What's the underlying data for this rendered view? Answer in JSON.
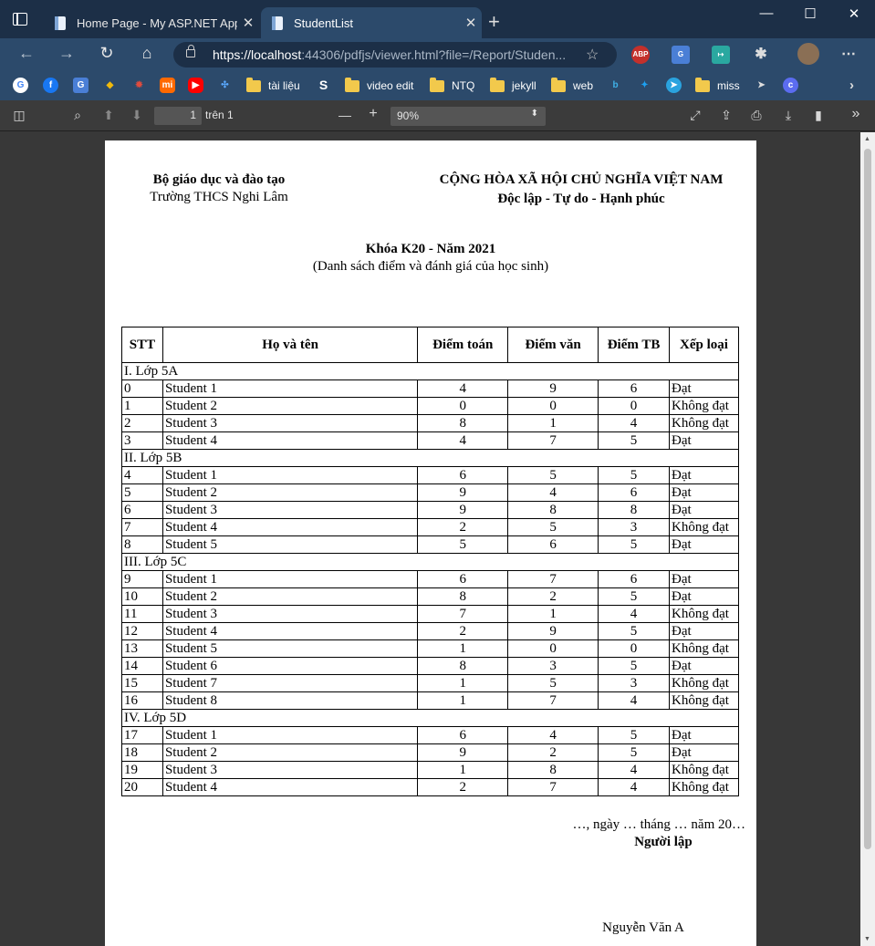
{
  "browser": {
    "tabs": [
      {
        "label": "Home Page - My ASP.NET Applic",
        "close": "✕"
      },
      {
        "label": "StudentList",
        "close": "✕"
      }
    ],
    "new_tab": "+",
    "window_controls": {
      "minimize": "—",
      "maximize": "☐",
      "close": "✕"
    },
    "url_host": "https://localhost",
    "url_rest": ":44306/pdfjs/viewer.html?file=/Report/Studen...",
    "bookmarks": [
      "tài liệu",
      "video edit",
      "NTQ",
      "jekyll",
      "web",
      "miss"
    ]
  },
  "pdf_toolbar": {
    "page_number": "1",
    "page_total": "trên 1",
    "zoom_minus": "—",
    "zoom_plus": "+",
    "zoom": "90%"
  },
  "document": {
    "ministry": "Bộ giáo dục và đào tạo",
    "school": "Trường THCS Nghi Lâm",
    "republic": "CỘNG HÒA XÃ HỘI CHỦ NGHĨA VIỆT NAM",
    "motto": "Độc lập - Tự do - Hạnh phúc",
    "course": "Khóa K20 - Năm 2021",
    "subtitle": "(Danh sách điểm và đánh giá của học sinh)",
    "columns": [
      "STT",
      "Họ và tên",
      "Điểm toán",
      "Điểm văn",
      "Điểm TB",
      "Xếp loại"
    ],
    "groups": [
      {
        "name": "I. Lớp 5A",
        "rows": [
          [
            "0",
            "Student 1",
            "4",
            "9",
            "6",
            "Đạt"
          ],
          [
            "1",
            "Student 2",
            "0",
            "0",
            "0",
            "Không đạt"
          ],
          [
            "2",
            "Student 3",
            "8",
            "1",
            "4",
            "Không đạt"
          ],
          [
            "3",
            "Student 4",
            "4",
            "7",
            "5",
            "Đạt"
          ]
        ]
      },
      {
        "name": "II. Lớp 5B",
        "rows": [
          [
            "4",
            "Student 1",
            "6",
            "5",
            "5",
            "Đạt"
          ],
          [
            "5",
            "Student 2",
            "9",
            "4",
            "6",
            "Đạt"
          ],
          [
            "6",
            "Student 3",
            "9",
            "8",
            "8",
            "Đạt"
          ],
          [
            "7",
            "Student 4",
            "2",
            "5",
            "3",
            "Không đạt"
          ],
          [
            "8",
            "Student 5",
            "5",
            "6",
            "5",
            "Đạt"
          ]
        ]
      },
      {
        "name": "III. Lớp 5C",
        "rows": [
          [
            "9",
            "Student 1",
            "6",
            "7",
            "6",
            "Đạt"
          ],
          [
            "10",
            "Student 2",
            "8",
            "2",
            "5",
            "Đạt"
          ],
          [
            "11",
            "Student 3",
            "7",
            "1",
            "4",
            "Không đạt"
          ],
          [
            "12",
            "Student 4",
            "2",
            "9",
            "5",
            "Đạt"
          ],
          [
            "13",
            "Student 5",
            "1",
            "0",
            "0",
            "Không đạt"
          ],
          [
            "14",
            "Student 6",
            "8",
            "3",
            "5",
            "Đạt"
          ],
          [
            "15",
            "Student 7",
            "1",
            "5",
            "3",
            "Không đạt"
          ],
          [
            "16",
            "Student 8",
            "1",
            "7",
            "4",
            "Không đạt"
          ]
        ]
      },
      {
        "name": "IV. Lớp 5D",
        "rows": [
          [
            "17",
            "Student 1",
            "6",
            "4",
            "5",
            "Đạt"
          ],
          [
            "18",
            "Student 2",
            "9",
            "2",
            "5",
            "Đạt"
          ],
          [
            "19",
            "Student 3",
            "1",
            "8",
            "4",
            "Không đạt"
          ],
          [
            "20",
            "Student 4",
            "2",
            "7",
            "4",
            "Không đạt"
          ]
        ]
      }
    ],
    "date_line": "…, ngày … tháng … năm 20…",
    "creator_label": "Người lập",
    "creator_name": "Nguyễn Văn A"
  }
}
